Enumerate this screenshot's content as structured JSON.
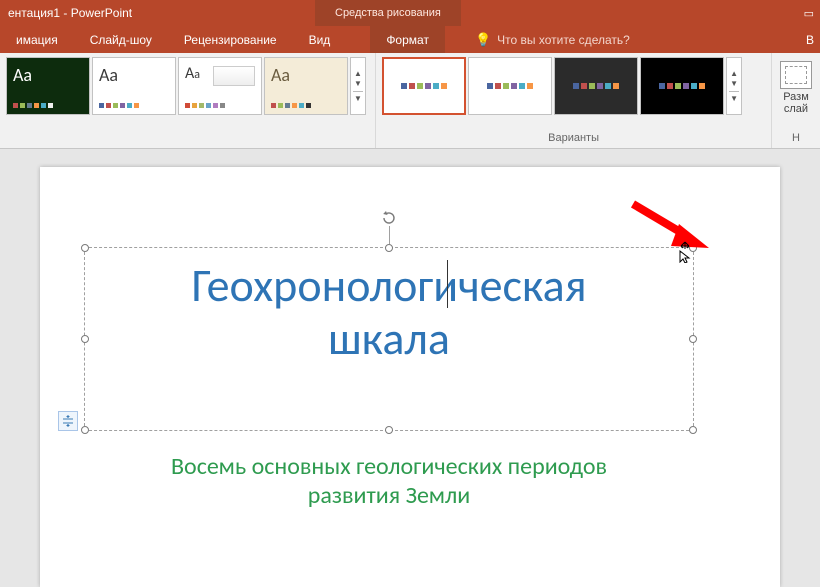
{
  "titlebar": {
    "doc": "ентация1 - PowerPoint",
    "context_tools": "Средства рисования"
  },
  "tabs": {
    "animation": "имация",
    "slideshow": "Слайд-шоу",
    "review": "Рецензирование",
    "view": "Вид",
    "format": "Формат",
    "tellme": "Что вы хотите сделать?",
    "login_frag": "В"
  },
  "ribbon": {
    "themes": {
      "items": [
        {
          "aa": "Aa",
          "bg": "#0d2c0d",
          "fg": "#ffffff",
          "strip": [
            "#c0504d",
            "#9bbb59",
            "#637a91",
            "#f79646",
            "#4bacc6",
            "#efefef"
          ]
        },
        {
          "aa": "Aa",
          "bg": "#ffffff",
          "fg": "#3a3a3a",
          "strip": [
            "#4a66a0",
            "#c0504d",
            "#9bbb59",
            "#8064a2",
            "#4bacc6",
            "#f79646"
          ]
        },
        {
          "aa": "Aa",
          "bg": "#ffffff",
          "fg": "#3a3a3a",
          "strip": [
            "#d04a37",
            "#e8a33d",
            "#a2b969",
            "#6aa4c8",
            "#b07cc0",
            "#888888"
          ],
          "special": true
        },
        {
          "aa": "Aa",
          "bg": "#f4ecd8",
          "fg": "#6a5c3f",
          "strip": [
            "#c0504d",
            "#9bbb59",
            "#637a91",
            "#f79646",
            "#4bacc6",
            "#333333"
          ]
        }
      ]
    },
    "variants": {
      "label": "Варианты",
      "items": [
        {
          "bg": "#ffffff",
          "strip": [
            "#4a66a0",
            "#c0504d",
            "#9bbb59",
            "#8064a2",
            "#4bacc6",
            "#f79646"
          ],
          "selected": true
        },
        {
          "bg": "#ffffff",
          "strip": [
            "#4a66a0",
            "#c0504d",
            "#9bbb59",
            "#8064a2",
            "#4bacc6",
            "#f79646"
          ]
        },
        {
          "bg": "#2b2b2b",
          "strip": [
            "#4a66a0",
            "#c0504d",
            "#9bbb59",
            "#8064a2",
            "#4bacc6",
            "#f79646"
          ]
        },
        {
          "bg": "#000000",
          "strip": [
            "#4a66a0",
            "#c0504d",
            "#9bbb59",
            "#8064a2",
            "#4bacc6",
            "#f79646"
          ]
        }
      ]
    },
    "size": {
      "line1": "Разм",
      "line2": "слай",
      "group_frag": "Н"
    }
  },
  "slide": {
    "title_l1": "Геохронологическая",
    "title_l2": "шкала",
    "subtitle_l1": "Восемь основных геологических периодов",
    "subtitle_l2": "развития Земли"
  }
}
